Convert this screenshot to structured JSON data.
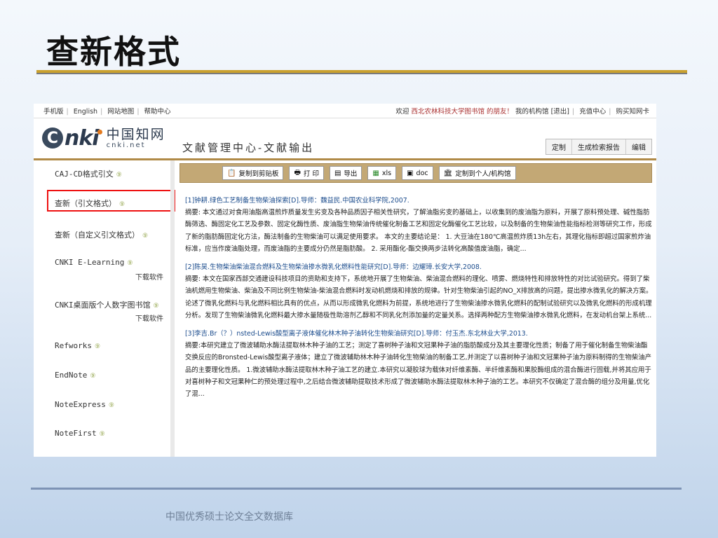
{
  "slide": {
    "title": "查新格式",
    "footer": "中国优秀硕士论文全文数据库"
  },
  "topbar": {
    "left_links": [
      "手机版",
      "English",
      "网站地图",
      "帮助中心"
    ],
    "welcome": "欢迎",
    "org": "西北农林科技大学图书馆 的朋友！",
    "right_links": [
      "我的机构馆",
      "[退出]",
      "充值中心",
      "购买知网卡"
    ]
  },
  "header": {
    "logo_c": "C",
    "logo_nki": "nki",
    "logo_cn": "中国知网",
    "logo_net": "cnki.net",
    "title": "文献管理中心-文献输出",
    "buttons": [
      "定制",
      "生成检索报告",
      "编辑"
    ]
  },
  "sidebar": {
    "items": [
      {
        "label": "CAJ-CD格式引文",
        "help": "⑨"
      },
      {
        "label": "查新（引文格式）",
        "help": "⑨"
      },
      {
        "label": "查新（自定义引文格式）",
        "help": "⑨"
      },
      {
        "label": "CNKI E-Learning",
        "help": "⑨",
        "sub": "下载软件"
      },
      {
        "label": "CNKI桌面版个人数字图书馆",
        "help": "⑨",
        "sub": "下载软件"
      },
      {
        "label": "Refworks",
        "help": "⑨"
      },
      {
        "label": "EndNote",
        "help": "⑨"
      },
      {
        "label": "NoteExpress",
        "help": "⑨"
      },
      {
        "label": "NoteFirst",
        "help": "⑨"
      }
    ]
  },
  "toolbar": {
    "buttons": [
      {
        "label": "复制到剪贴板",
        "icon": "clipboard-icon"
      },
      {
        "label": "打 印",
        "icon": "printer-icon"
      },
      {
        "label": "导出",
        "icon": "export-icon"
      },
      {
        "label": "xls",
        "icon": "excel-icon"
      },
      {
        "label": "doc",
        "icon": "save-icon"
      },
      {
        "label": "定制到个人/机构馆",
        "icon": "library-icon"
      }
    ]
  },
  "entries": [
    {
      "title": "[1]钟耕.绿色工艺制备生物柴油探索[D].导师：魏益民.中国农业科学院,2007.",
      "abstract": "摘要: 本文通过对食用油脂高温煎炸质量发生劣变及各种品质因子相关性研究，了解油脂劣变的基础上，以收集到的废油脂为原料，开展了原料预处理、碱性脂肪酶筛选、酶固定化工艺及参数、固定化酶性质、废油脂生物柴油传统催化制备工艺和固定化酶催化工艺比较，以及制备的生物柴油性能指标检测等研究工作，形成了新的脂肪酶固定化方法，酶法制备的生物柴油可以满足使用要求。 本文的主要结论是： 1. 大豆油在180℃高温煎炸质13h左右，其理化指标即超过国家煎炸油标准，应当作废油脂处理，而废油脂的主要成分仍然是脂肪酸。 2. 采用酯化-酯交换两步法转化高酸值废油脂，确定..."
    },
    {
      "title": "[2]陈昊.生物柴油柴油混合燃料及生物柴油掺水微乳化燃料性能研究[D].导师：边耀璋.长安大学,2008.",
      "abstract": "摘要: 本文在国家西部交通建设科技项目的资助和支持下，系统地开展了生物柴油、柴油混合燃料的理化、喷雾、燃烧特性和排放特性的对比试验研究。得到了柴油机燃用生物柴油、柴油及不同比例生物柴油-柴油混合燃料时发动机燃烧和排放的规律。针对生物柴油引起的NO_X排放高的问题，提出掺水微乳化的解决方案。论述了微乳化燃料与乳化燃料相比具有的优点，从而以形成微乳化燃料为前提，系统地进行了生物柴油掺水微乳化燃料的配制试验研究以及微乳化燃料的形成机理分析。发现了生物柴油微乳化燃料最大掺水量随极性助溶剂乙醇和不同乳化剂添加量的定量关系。选择两种配方生物柴油掺水微乳化燃料，在发动机台架上系统..."
    },
    {
      "title": "[3]李吉.Br（？）nsted-Lewis酸型离子液体催化林木种子油转化生物柴油研究[D].导师：付玉杰.东北林业大学,2013.",
      "abstract": "摘要:本研究建立了微波辅助水酶法提取林木种子油的工艺；测定了喜树种子油和文冠果种子油的脂肪酸成分及其主要理化性质；制备了用于催化制备生物柴油酯交换反应的Bronsted-Lewis酸型离子液体；建立了微波辅助林木种子油转化生物柴油的制备工艺,并测定了以喜树种子油和文冠果种子油为原料制得的生物柴油产品的主要理化性质。 1.微波辅助水酶法提取林木种子油工艺的建立.本研究以凝胶球为载体对纤维素酶、半纤维素酶和果胶酶组成的混合酶进行固载,并将其应用于对喜树种子和文冠果种仁的预处理过程中,之后结合微波辅助提取技术形成了微波辅助水酶法提取林木种子油的工艺。本研究不仅确定了混合酶的组分及用量,优化了混..."
    }
  ]
}
